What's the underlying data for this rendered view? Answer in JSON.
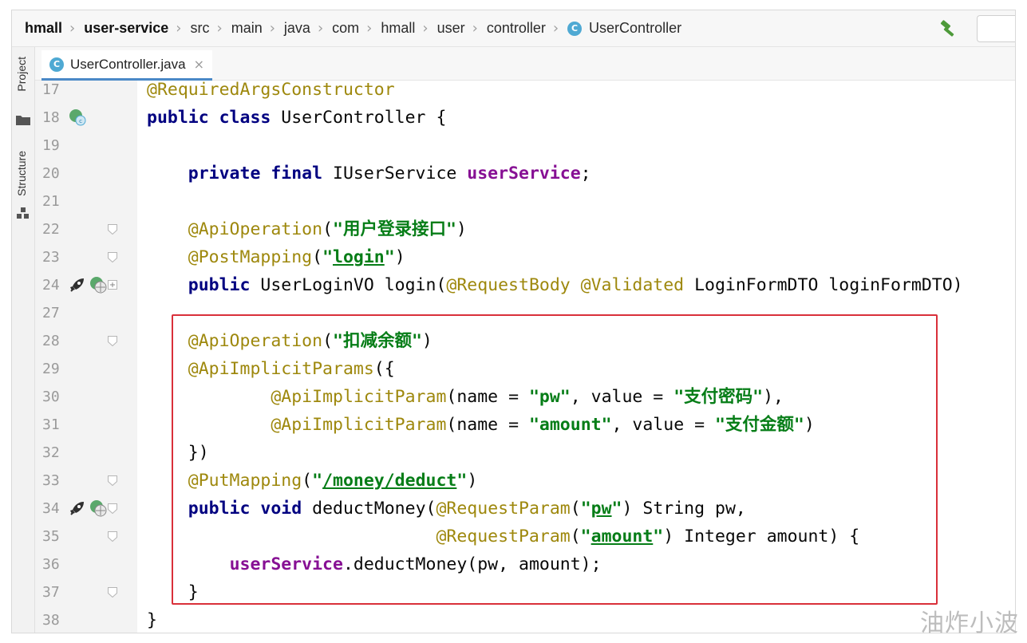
{
  "breadcrumb": [
    {
      "label": "hmall",
      "bold": true
    },
    {
      "label": "user-service",
      "bold": true
    },
    {
      "label": "src"
    },
    {
      "label": "main"
    },
    {
      "label": "java"
    },
    {
      "label": "com"
    },
    {
      "label": "hmall"
    },
    {
      "label": "user"
    },
    {
      "label": "controller"
    },
    {
      "label": "UserController",
      "class_icon": "C"
    }
  ],
  "toolstrip": {
    "project_label": "Project",
    "structure_label": "Structure"
  },
  "tab": {
    "icon_letter": "C",
    "name": "UserController.java",
    "close": "×"
  },
  "watermark": "油炸小波",
  "colors": {
    "highlight_border": "#d9303a",
    "keyword": "#000080",
    "annotation": "#9e880d",
    "string": "#067d17",
    "field": "#871094"
  },
  "lines": [
    {
      "num": "17",
      "tokens": [
        {
          "t": "@RequiredArgsConstructor",
          "c": "ann"
        }
      ]
    },
    {
      "num": "18",
      "icons": [
        "bean-icon"
      ],
      "tokens": [
        {
          "t": "public class ",
          "c": "kw"
        },
        {
          "t": "UserController {"
        }
      ]
    },
    {
      "num": "19",
      "tokens": []
    },
    {
      "num": "20",
      "tokens": [
        {
          "t": "    "
        },
        {
          "t": "private final ",
          "c": "kw"
        },
        {
          "t": "IUserService "
        },
        {
          "t": "userService",
          "c": "fld"
        },
        {
          "t": ";"
        }
      ]
    },
    {
      "num": "21",
      "tokens": []
    },
    {
      "num": "22",
      "fold": true,
      "tokens": [
        {
          "t": "    "
        },
        {
          "t": "@ApiOperation",
          "c": "ann"
        },
        {
          "t": "("
        },
        {
          "t": "\"用户登录接口\"",
          "c": "str"
        },
        {
          "t": ")"
        }
      ]
    },
    {
      "num": "23",
      "fold": true,
      "tokens": [
        {
          "t": "    "
        },
        {
          "t": "@PostMapping",
          "c": "ann"
        },
        {
          "t": "("
        },
        {
          "t": "\"",
          "c": "str"
        },
        {
          "t": "login",
          "c": "str",
          "u": true
        },
        {
          "t": "\"",
          "c": "str"
        },
        {
          "t": ")"
        }
      ]
    },
    {
      "num": "24",
      "icons": [
        "rocket-icon",
        "web-icon"
      ],
      "fold": "plus",
      "tokens": [
        {
          "t": "    "
        },
        {
          "t": "public ",
          "c": "kw"
        },
        {
          "t": "UserLoginVO login("
        },
        {
          "t": "@RequestBody @Validated ",
          "c": "ann"
        },
        {
          "t": "LoginFormDTO loginFormDTO)"
        }
      ]
    },
    {
      "num": "27",
      "tokens": []
    },
    {
      "num": "28",
      "fold": true,
      "tokens": [
        {
          "t": "    "
        },
        {
          "t": "@ApiOperation",
          "c": "ann"
        },
        {
          "t": "("
        },
        {
          "t": "\"扣减余额\"",
          "c": "str"
        },
        {
          "t": ")"
        }
      ]
    },
    {
      "num": "29",
      "tokens": [
        {
          "t": "    "
        },
        {
          "t": "@ApiImplicitParams",
          "c": "ann"
        },
        {
          "t": "({"
        }
      ]
    },
    {
      "num": "30",
      "tokens": [
        {
          "t": "            "
        },
        {
          "t": "@ApiImplicitParam",
          "c": "ann"
        },
        {
          "t": "(name = "
        },
        {
          "t": "\"pw\"",
          "c": "str"
        },
        {
          "t": ", value = "
        },
        {
          "t": "\"支付密码\"",
          "c": "str"
        },
        {
          "t": "),"
        }
      ]
    },
    {
      "num": "31",
      "tokens": [
        {
          "t": "            "
        },
        {
          "t": "@ApiImplicitParam",
          "c": "ann"
        },
        {
          "t": "(name = "
        },
        {
          "t": "\"amount\"",
          "c": "str"
        },
        {
          "t": ", value = "
        },
        {
          "t": "\"支付金额\"",
          "c": "str"
        },
        {
          "t": ")"
        }
      ]
    },
    {
      "num": "32",
      "tokens": [
        {
          "t": "    })"
        }
      ]
    },
    {
      "num": "33",
      "fold": true,
      "tokens": [
        {
          "t": "    "
        },
        {
          "t": "@PutMapping",
          "c": "ann"
        },
        {
          "t": "("
        },
        {
          "t": "\"",
          "c": "str"
        },
        {
          "t": "/money/deduct",
          "c": "str",
          "u": true
        },
        {
          "t": "\"",
          "c": "str"
        },
        {
          "t": ")"
        }
      ]
    },
    {
      "num": "34",
      "icons": [
        "rocket-icon",
        "web-icon"
      ],
      "fold": true,
      "tokens": [
        {
          "t": "    "
        },
        {
          "t": "public void ",
          "c": "kw"
        },
        {
          "t": "deductMoney("
        },
        {
          "t": "@RequestParam",
          "c": "ann"
        },
        {
          "t": "("
        },
        {
          "t": "\"",
          "c": "str"
        },
        {
          "t": "pw",
          "c": "str",
          "u": true
        },
        {
          "t": "\"",
          "c": "str"
        },
        {
          "t": ") String pw,"
        }
      ]
    },
    {
      "num": "35",
      "fold": true,
      "tokens": [
        {
          "t": "                            "
        },
        {
          "t": "@RequestParam",
          "c": "ann"
        },
        {
          "t": "("
        },
        {
          "t": "\"",
          "c": "str"
        },
        {
          "t": "amount",
          "c": "str",
          "u": true
        },
        {
          "t": "\"",
          "c": "str"
        },
        {
          "t": ") Integer amount) {"
        }
      ]
    },
    {
      "num": "36",
      "tokens": [
        {
          "t": "        "
        },
        {
          "t": "userService",
          "c": "fld"
        },
        {
          "t": ".deductMoney(pw, amount);"
        }
      ]
    },
    {
      "num": "37",
      "fold": true,
      "tokens": [
        {
          "t": "    }"
        }
      ]
    },
    {
      "num": "38",
      "tokens": [
        {
          "t": "}"
        }
      ]
    }
  ]
}
